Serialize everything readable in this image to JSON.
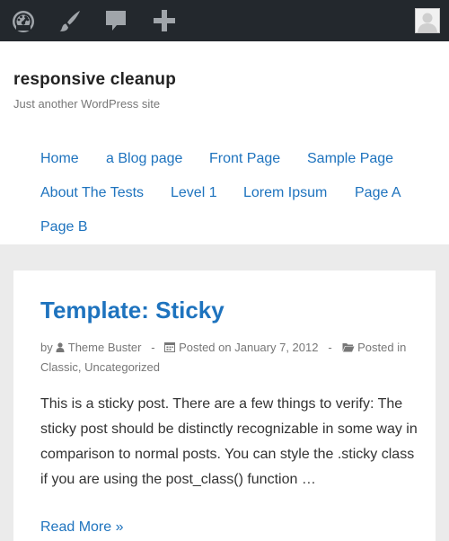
{
  "admin_bar": {
    "icons": [
      "dashboard-icon",
      "customize-brush-icon",
      "comments-icon",
      "new-content-plus-icon",
      "user-avatar"
    ]
  },
  "site": {
    "title": "responsive cleanup",
    "description": "Just another WordPress site"
  },
  "nav": {
    "items": [
      "Home",
      "a Blog page",
      "Front Page",
      "Sample Page",
      "About The Tests",
      "Level 1",
      "Lorem Ipsum",
      "Page A",
      "Page B"
    ]
  },
  "post": {
    "title": "Template: Sticky",
    "by": "by",
    "author": "Theme Buster",
    "separator": "-",
    "posted_on_label": "Posted on",
    "date": "January 7, 2012",
    "posted_in_label": "Posted in",
    "category_1": "Classic",
    "category_sep": ",",
    "category_2": "Uncategorized",
    "excerpt": "This is a sticky post. There are a few things to verify: The sticky post should be distinctly recognizable in some way in comparison to normal posts. You can style the .sticky class if you are using the post_class() function …",
    "read_more": "Read More »"
  },
  "colors": {
    "admin_bar": "#23282d",
    "link": "#1e73be",
    "background": "#ebebeb"
  }
}
